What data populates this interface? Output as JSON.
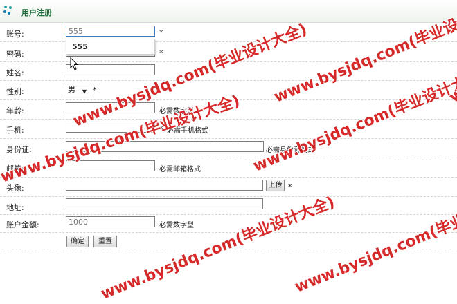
{
  "header": {
    "title": "用户注册"
  },
  "form": {
    "account": {
      "label": "账号:",
      "value": "555",
      "required": "*"
    },
    "autocomplete": {
      "suggestion": "555"
    },
    "password": {
      "label": "密码:",
      "value": "",
      "required": "*"
    },
    "name": {
      "label": "姓名:",
      "value": ""
    },
    "gender": {
      "label": "性别:",
      "selected": "男",
      "required": "*"
    },
    "age": {
      "label": "年龄:",
      "value": "",
      "hint": "必需数字型"
    },
    "phone": {
      "label": "手机:",
      "value": "",
      "required": "*",
      "hint": "必需手机格式"
    },
    "idcard": {
      "label": "身份证:",
      "value": "",
      "hint": "必需身份证格式"
    },
    "email": {
      "label": "邮箱:",
      "value": "",
      "hint": "必需邮箱格式"
    },
    "avatar": {
      "label": "头像:",
      "value": "",
      "upload_label": "上传",
      "required": "*"
    },
    "address": {
      "label": "地址:",
      "value": ""
    },
    "balance": {
      "label": "账户金额:",
      "placeholder": "1000",
      "hint": "必需数字型"
    },
    "buttons": {
      "confirm": "确定",
      "reset": "重置"
    }
  },
  "watermark": {
    "text": "www.bysjdq.com(毕业设计大全)",
    "color": "#d41f1f"
  }
}
